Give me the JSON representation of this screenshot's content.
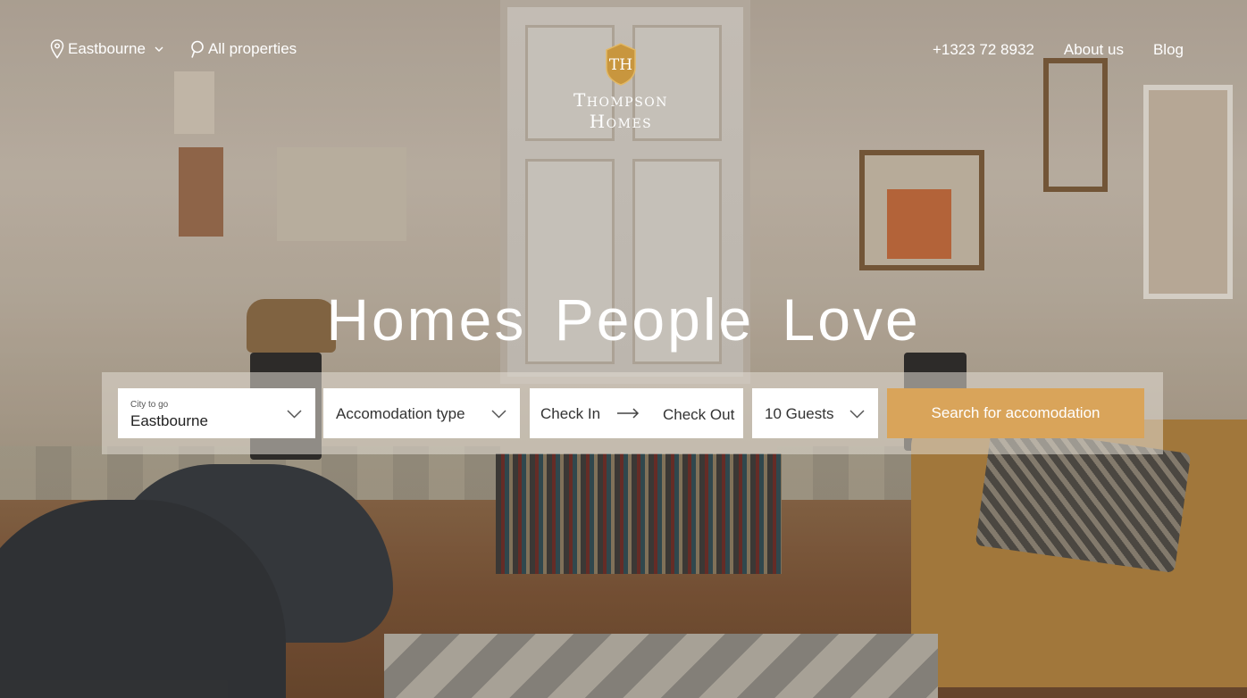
{
  "header": {
    "city_select_label": "Eastbourne",
    "all_properties_label": "All properties",
    "logo": {
      "line1": "Thompson",
      "line2": "Homes",
      "monogram": "TH"
    },
    "phone": "+1323 72 8932",
    "about_label": "About us",
    "blog_label": "Blog"
  },
  "hero": {
    "title": "Homes People Love"
  },
  "search": {
    "city_label": "City to go",
    "city_value": "Eastbourne",
    "accommodation_placeholder": "Accomodation type",
    "check_in": "Check In",
    "check_out": "Check Out",
    "guests": "10 Guests",
    "submit_label": "Search for accomodation"
  },
  "colors": {
    "accent": "#d9a45a",
    "logo_gold": "#c8963e",
    "text_light": "#ffffff"
  },
  "icons": [
    "map-pin-icon",
    "chevron-down-icon",
    "search-icon",
    "logo-crest-icon",
    "arrow-right-icon"
  ]
}
